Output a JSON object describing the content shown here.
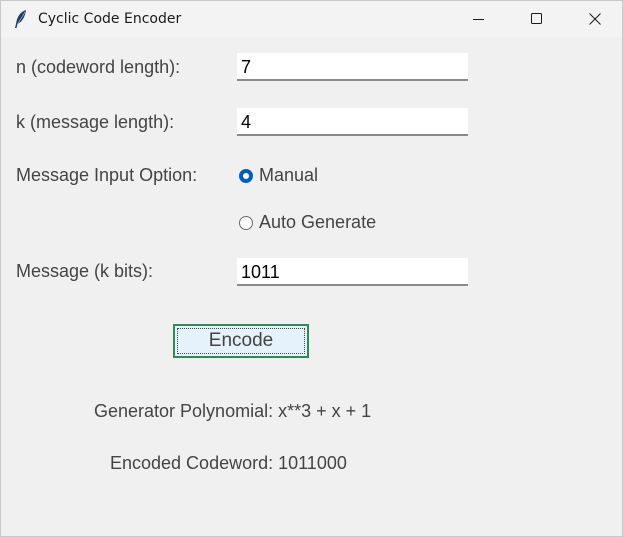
{
  "window": {
    "title": "Cyclic Code Encoder",
    "controls": [
      "minimize-icon",
      "maximize-icon",
      "close-icon"
    ]
  },
  "form": {
    "n_label": "n (codeword length):",
    "n_value": "7",
    "k_label": "k (message length):",
    "k_value": "4",
    "option_label": "Message Input Option:",
    "options": [
      {
        "label": "Manual",
        "selected": true
      },
      {
        "label": "Auto Generate",
        "selected": false
      }
    ],
    "message_label": "Message (k bits):",
    "message_value": "1011",
    "encode_label": "Encode"
  },
  "results": {
    "generator": "Generator Polynomial: x**3 + x + 1",
    "codeword": "Encoded Codeword: 1011000"
  },
  "colors": {
    "radio_selected": "#005fb8",
    "button_border": "#2e8b57",
    "button_bg": "#e5f1fb"
  }
}
